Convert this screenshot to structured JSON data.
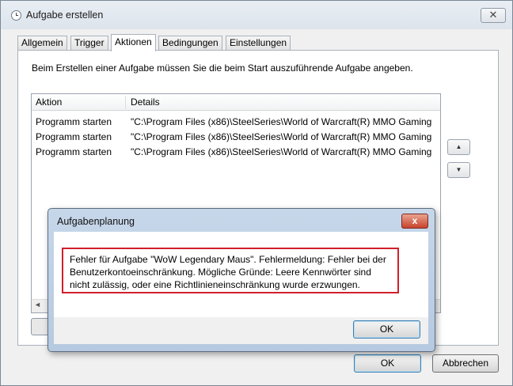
{
  "window": {
    "title": "Aufgabe erstellen",
    "close_glyph": "✕"
  },
  "tabs": [
    {
      "label": "Allgemein"
    },
    {
      "label": "Trigger"
    },
    {
      "label": "Aktionen",
      "active": true
    },
    {
      "label": "Bedingungen"
    },
    {
      "label": "Einstellungen"
    }
  ],
  "panel": {
    "description": "Beim Erstellen einer Aufgabe müssen Sie die beim Start auszuführende Aufgabe angeben."
  },
  "actions_table": {
    "columns": [
      "Aktion",
      "Details"
    ],
    "rows": [
      {
        "action": "Programm starten",
        "details": "\"C:\\Program Files (x86)\\SteelSeries\\World of Warcraft(R) MMO Gaming"
      },
      {
        "action": "Programm starten",
        "details": "\"C:\\Program Files (x86)\\SteelSeries\\World of Warcraft(R) MMO Gaming"
      },
      {
        "action": "Programm starten",
        "details": "\"C:\\Program Files (x86)\\SteelSeries\\World of Warcraft(R) MMO Gaming"
      }
    ]
  },
  "arrows": {
    "up": "▲",
    "down": "▼",
    "left": "◄"
  },
  "buttons": {
    "ok": "OK",
    "cancel": "Abbrechen"
  },
  "dialog": {
    "title": "Aufgabenplanung",
    "close_glyph": "x",
    "message": "Fehler für Aufgabe \"WoW Legendary Maus\". Fehlermeldung: Fehler bei der Benutzerkontoeinschränkung. Mögliche Gründe: Leere Kennwörter sind nicht zulässig, oder eine Richtlinieneinschränkung wurde erzwungen.",
    "ok_label": "OK"
  },
  "colors": {
    "error_border": "#d0202a",
    "dialog_frame": "#b5c9e0",
    "close_red": "#c8432b"
  }
}
